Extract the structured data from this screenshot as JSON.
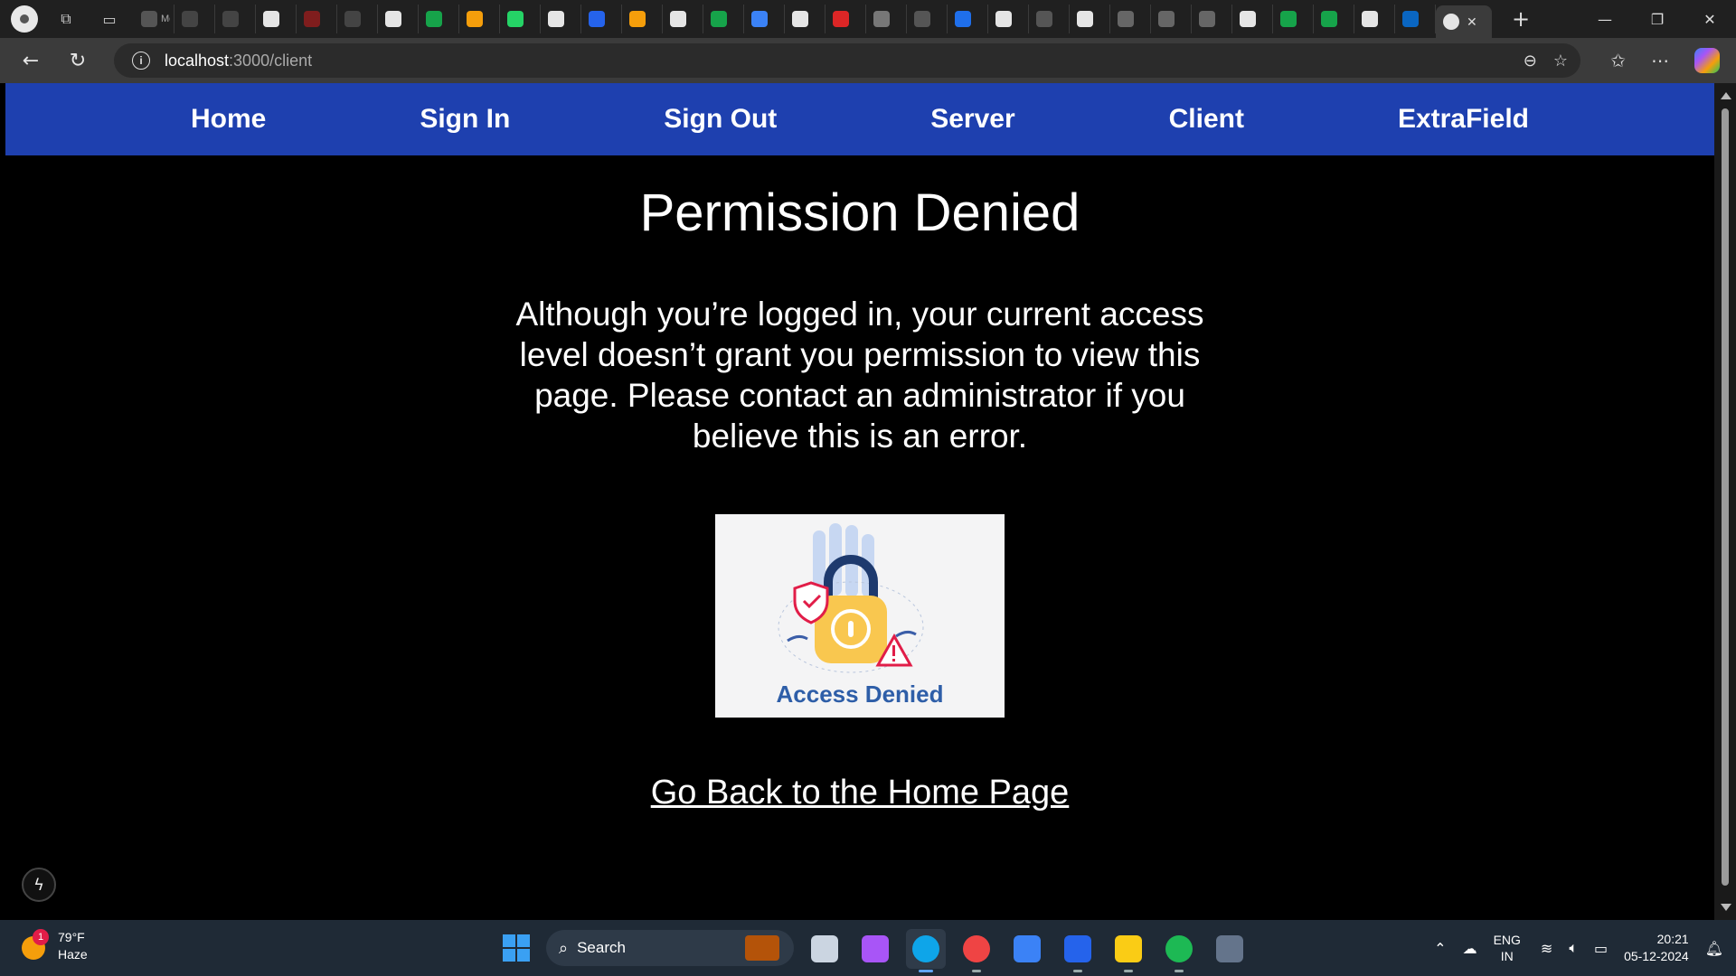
{
  "browser": {
    "tab_close_glyph": "✕",
    "new_tab_glyph": "+",
    "window_controls": [
      "—",
      "❐",
      "✕"
    ],
    "url_host": "localhost",
    "url_path": ":3000/client",
    "back_glyph": "←",
    "reload_glyph": "↻",
    "info_glyph": "i",
    "tab_favicon_colors": [
      "#555555",
      "#444444",
      "#444444",
      "#e5e5e5",
      "#7f1d1d",
      "#444444",
      "#e5e5e5",
      "#16a34a",
      "#f59e0b",
      "#25d366",
      "#e5e5e5",
      "#2563eb",
      "#f59e0b",
      "#e5e5e5",
      "#16a34a",
      "#3b82f6",
      "#e5e5e5",
      "#dc2626",
      "#777777",
      "#555555",
      "#1f6feb",
      "#e5e5e5",
      "#555555",
      "#e5e5e5",
      "#666666",
      "#666666",
      "#666666",
      "#e5e5e5",
      "#16a34a",
      "#16a34a",
      "#e5e5e5",
      "#0a66c2"
    ],
    "tab_title_fragments": [
      "Mc",
      "",
      "",
      "",
      "",
      "",
      "",
      "",
      "",
      "",
      "",
      "",
      "",
      "",
      "",
      "",
      "",
      "",
      "",
      "",
      "",
      "",
      "",
      "",
      "",
      "",
      "",
      "",
      "",
      "",
      "",
      ""
    ]
  },
  "site_nav": {
    "items": [
      "Home",
      "Sign In",
      "Sign Out",
      "Server",
      "Client",
      "ExtraField"
    ]
  },
  "page": {
    "heading": "Permission Denied",
    "message": "Although you’re logged in, your current access level doesn’t grant you permission to view this page. Please contact an administrator if you believe this is an error.",
    "image_caption": "Access Denied",
    "home_link": "Go Back to the Home Page",
    "dev_badge_glyph": "ϟ"
  },
  "taskbar": {
    "weather_temp": "79°F",
    "weather_desc": "Haze",
    "weather_badge": "1",
    "search_label": "Search",
    "lang_line1": "ENG",
    "lang_line2": "IN",
    "time": "20:21",
    "date": "05-12-2024",
    "app_colors": [
      "#cbd5e1",
      "#a855f7",
      "#0ea5e9",
      "#ef4444",
      "#3b82f6",
      "#2563eb",
      "#facc15",
      "#1db954",
      "#64748b"
    ],
    "accent": "#1e40af"
  }
}
